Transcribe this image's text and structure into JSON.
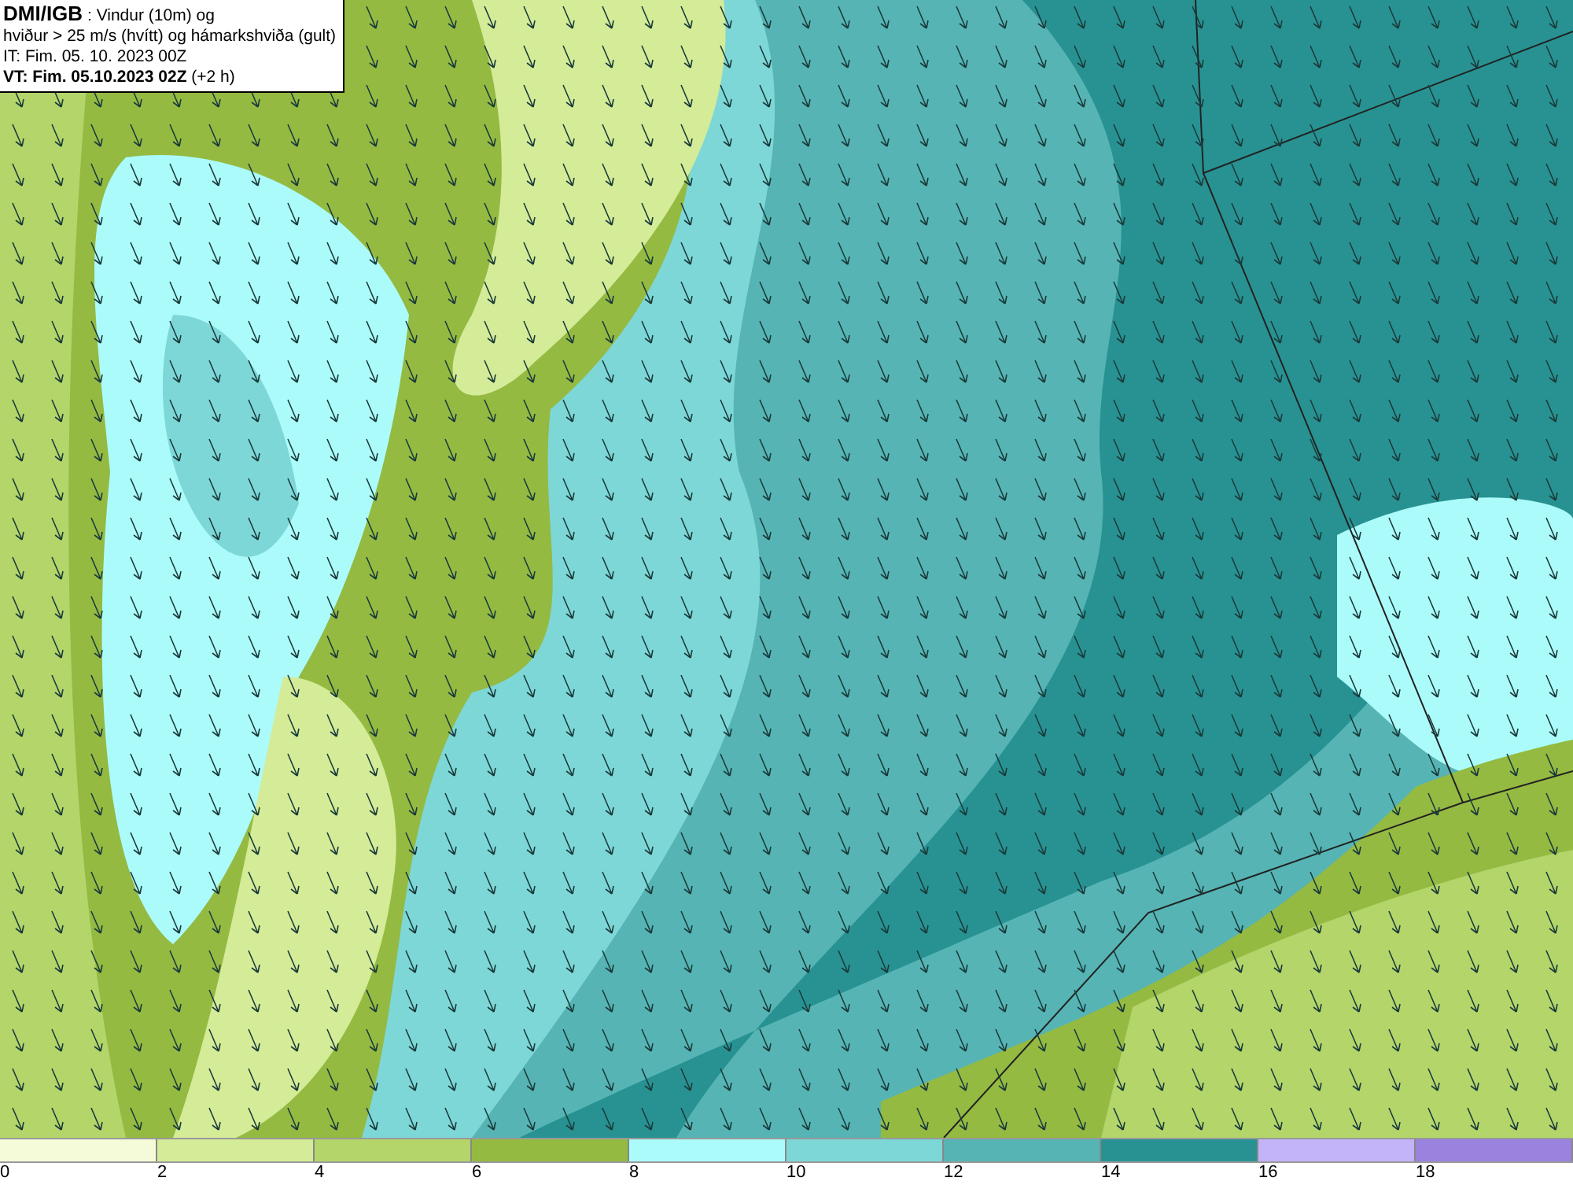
{
  "caption": [
    "**DMI/IGB** : Vindur (10m) og",
    "hviður > 25 m/s (hvítt) og hámarkshviða (gult)",
    "IT: Fim. 05. 10. 2023 00Z",
    "**VT: Fim. 05.10.2023 02Z** (+2 h)"
  ],
  "legend": {
    "bins": [
      {
        "color": "#f5fbd9"
      },
      {
        "color": "#d4eb98"
      },
      {
        "color": "#b3d56a"
      },
      {
        "color": "#94ba42"
      },
      {
        "color": "#acfbfb"
      },
      {
        "color": "#7ed7d7"
      },
      {
        "color": "#56b4b4"
      },
      {
        "color": "#289292"
      },
      {
        "color": "#c3b3f7"
      },
      {
        "color": "#9a83df"
      }
    ],
    "ticks": [
      "0",
      "2",
      "4",
      "6",
      "8",
      "10",
      "12",
      "14",
      "16",
      "18"
    ]
  }
}
